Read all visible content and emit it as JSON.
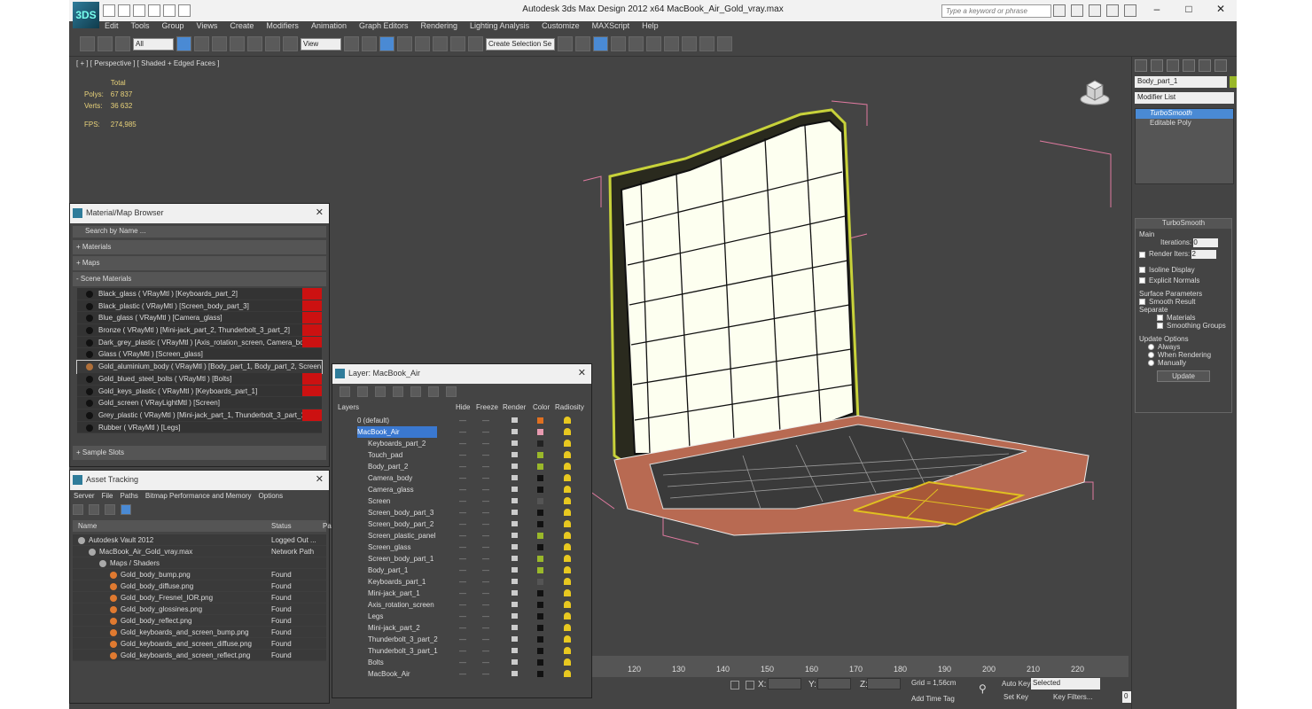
{
  "app": {
    "logo": "3DS",
    "title": "Autodesk 3ds Max Design 2012 x64     MacBook_Air_Gold_vray.max",
    "search_placeholder": "Type a keyword or phrase"
  },
  "menu": [
    "Edit",
    "Tools",
    "Group",
    "Views",
    "Create",
    "Modifiers",
    "Animation",
    "Graph Editors",
    "Rendering",
    "Lighting Analysis",
    "Customize",
    "MAXScript",
    "Help"
  ],
  "toolbar": {
    "filter": "All",
    "ref_coord": "View",
    "selection_set": "Create Selection Se"
  },
  "viewport": {
    "label": "[ + ] [ Perspective ] [ Shaded + Edged Faces ]",
    "stats_header": "Total",
    "polys_label": "Polys:",
    "polys": "67 837",
    "verts_label": "Verts:",
    "verts": "36 632",
    "fps_label": "FPS:",
    "fps": "274,985"
  },
  "timeline": {
    "ticks": [
      "120",
      "130",
      "140",
      "150",
      "160",
      "170",
      "180",
      "190",
      "200",
      "210",
      "220"
    ]
  },
  "status": {
    "x_label": "X:",
    "y_label": "Y:",
    "z_label": "Z:",
    "grid": "Grid = 1,56cm",
    "auto_key": "Auto Key",
    "selected": "Selected",
    "set_key": "Set Key",
    "key_filters": "Key Filters...",
    "add_time_tag": "Add Time Tag",
    "frame": "0"
  },
  "cmdpanel": {
    "object_name": "Body_part_1",
    "modifier_list": "Modifier List",
    "stack": [
      "TurboSmooth",
      "Editable Poly"
    ],
    "turbosmooth": {
      "title": "TurboSmooth",
      "main": "Main",
      "iterations_label": "Iterations:",
      "iterations": "0",
      "render_iters_label": "Render Iters:",
      "render_iters": "2",
      "isoline": "Isoline Display",
      "explicit": "Explicit Normals",
      "surface": "Surface Parameters",
      "smooth_result": "Smooth Result",
      "separate": "Separate",
      "materials": "Materials",
      "smoothing_groups": "Smoothing Groups",
      "update_options": "Update Options",
      "always": "Always",
      "when_rendering": "When Rendering",
      "manually": "Manually",
      "update": "Update"
    }
  },
  "material_browser": {
    "title": "Material/Map Browser",
    "search": "Search by Name ...",
    "materials": "+ Materials",
    "maps": "+ Maps",
    "scene_materials": "- Scene Materials",
    "sample_slots": "+ Sample Slots",
    "items": [
      "Black_glass ( VRayMtl ) [Keyboards_part_2]",
      "Black_plastic ( VRayMtl ) [Screen_body_part_3]",
      "Blue_glass ( VRayMtl ) [Camera_glass]",
      "Bronze ( VRayMtl ) [Mini-jack_part_2, Thunderbolt_3_part_2]",
      "Dark_grey_plastic ( VRayMtl ) [Axis_rotation_screen, Camera_body, Sc...",
      "Glass ( VRayMtl ) [Screen_glass]",
      "Gold_aluminium_body ( VRayMtl ) [Body_part_1, Body_part_2, Screen...",
      "Gold_blued_steel_bolts ( VRayMtl ) [Bolts]",
      "Gold_keys_plastic ( VRayMtl ) [Keyboards_part_1]",
      "Gold_screen ( VRayLightMtl ) [Screen]",
      "Grey_plastic ( VRayMtl ) [Mini-jack_part_1, Thunderbolt_3_part_1]",
      "Rubber ( VRayMtl ) [Legs]"
    ]
  },
  "asset_tracking": {
    "title": "Asset Tracking",
    "menu": [
      "Server",
      "File",
      "Paths",
      "Bitmap Performance and Memory",
      "Options"
    ],
    "col_name": "Name",
    "col_status": "Status",
    "col_p": "Pa",
    "rows": [
      {
        "name": "Autodesk Vault 2012",
        "status": "Logged Out ..."
      },
      {
        "name": "MacBook_Air_Gold_vray.max",
        "status": "Network Path"
      },
      {
        "name": "Maps / Shaders",
        "status": ""
      },
      {
        "name": "Gold_body_bump.png",
        "status": "Found"
      },
      {
        "name": "Gold_body_diffuse.png",
        "status": "Found"
      },
      {
        "name": "Gold_body_Fresnel_IOR.png",
        "status": "Found"
      },
      {
        "name": "Gold_body_glossines.png",
        "status": "Found"
      },
      {
        "name": "Gold_body_reflect.png",
        "status": "Found"
      },
      {
        "name": "Gold_keyboards_and_screen_bump.png",
        "status": "Found"
      },
      {
        "name": "Gold_keyboards_and_screen_diffuse.png",
        "status": "Found"
      },
      {
        "name": "Gold_keyboards_and_screen_reflect.png",
        "status": "Found"
      }
    ]
  },
  "layer_manager": {
    "title": "Layer: MacBook_Air",
    "cols": [
      "Layers",
      "Hide",
      "Freeze",
      "Render",
      "Color",
      "Radiosity"
    ],
    "rows": [
      {
        "name": "0 (default)",
        "color": "#e07020"
      },
      {
        "name": "MacBook_Air",
        "color": "#e89ab0"
      },
      {
        "name": "Keyboards_part_2",
        "color": "#222"
      },
      {
        "name": "Touch_pad",
        "color": "#9ab82a"
      },
      {
        "name": "Body_part_2",
        "color": "#9ab82a"
      },
      {
        "name": "Camera_body",
        "color": "#111"
      },
      {
        "name": "Camera_glass",
        "color": "#111"
      },
      {
        "name": "Screen",
        "color": "#555"
      },
      {
        "name": "Screen_body_part_3",
        "color": "#111"
      },
      {
        "name": "Screen_body_part_2",
        "color": "#111"
      },
      {
        "name": "Screen_plastic_panel",
        "color": "#9ab82a"
      },
      {
        "name": "Screen_glass",
        "color": "#111"
      },
      {
        "name": "Screen_body_part_1",
        "color": "#9ab82a"
      },
      {
        "name": "Body_part_1",
        "color": "#9ab82a"
      },
      {
        "name": "Keyboards_part_1",
        "color": "#555"
      },
      {
        "name": "Mini-jack_part_1",
        "color": "#111"
      },
      {
        "name": "Axis_rotation_screen",
        "color": "#111"
      },
      {
        "name": "Legs",
        "color": "#111"
      },
      {
        "name": "Mini-jack_part_2",
        "color": "#111"
      },
      {
        "name": "Thunderbolt_3_part_2",
        "color": "#111"
      },
      {
        "name": "Thunderbolt_3_part_1",
        "color": "#111"
      },
      {
        "name": "Bolts",
        "color": "#111"
      },
      {
        "name": "MacBook_Air",
        "color": "#111"
      }
    ]
  }
}
